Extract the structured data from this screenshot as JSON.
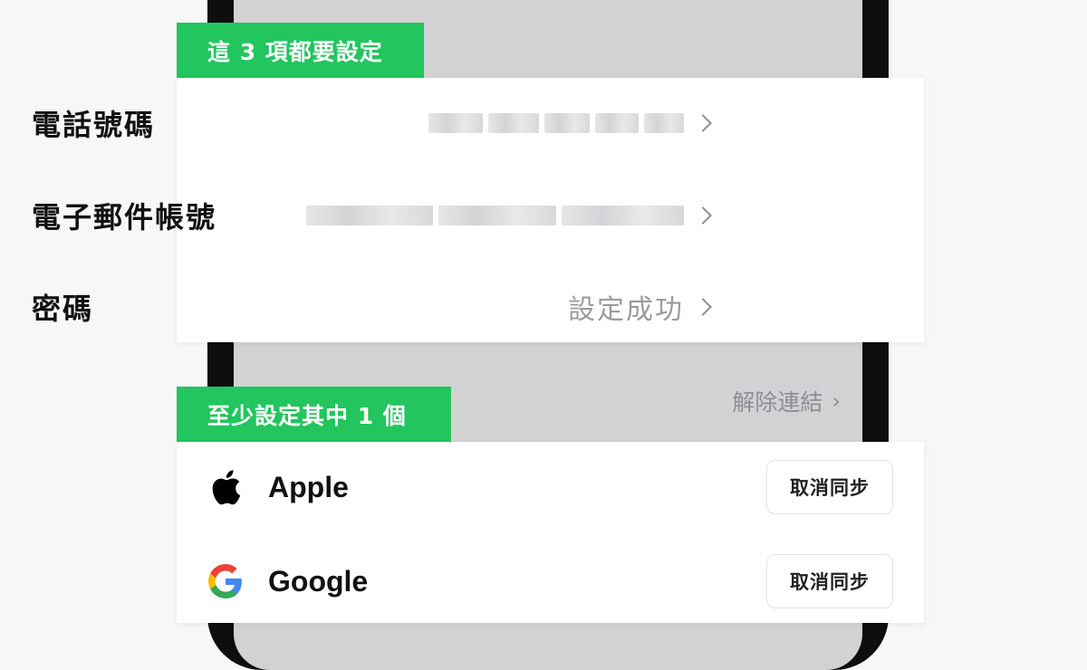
{
  "sections": {
    "required_badge": "這 3 項都要設定",
    "one_required_badge": "至少設定其中 1 個"
  },
  "profile_rows": [
    {
      "label": "電話號碼",
      "value_hidden": true
    },
    {
      "label": "電子郵件帳號",
      "value_hidden": true
    },
    {
      "label": "密碼",
      "value": "設定成功"
    }
  ],
  "background_row": {
    "label": "解除連結"
  },
  "linked_accounts": [
    {
      "name": "Apple",
      "icon": "apple-icon",
      "button_label": "取消同步"
    },
    {
      "name": "Google",
      "icon": "google-icon",
      "button_label": "取消同步"
    }
  ],
  "colors": {
    "accent_green": "#22c55e",
    "muted_text": "#9a9a9f"
  }
}
